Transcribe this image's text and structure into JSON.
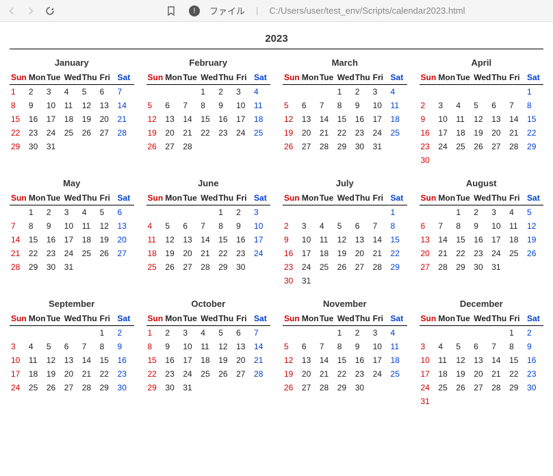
{
  "toolbar": {
    "file_label": "ファイル",
    "path": "C:/Users/user/test_env/Scripts/calendar2023.html"
  },
  "title": "2023",
  "weekdays": [
    "Sun",
    "Mon",
    "Tue",
    "Wed",
    "Thu",
    "Fri",
    "Sat"
  ],
  "months": [
    {
      "name": "January",
      "start": 0,
      "days": 31
    },
    {
      "name": "February",
      "start": 3,
      "days": 28
    },
    {
      "name": "March",
      "start": 3,
      "days": 31
    },
    {
      "name": "April",
      "start": 6,
      "days": 30
    },
    {
      "name": "May",
      "start": 1,
      "days": 31
    },
    {
      "name": "June",
      "start": 4,
      "days": 30
    },
    {
      "name": "July",
      "start": 6,
      "days": 31
    },
    {
      "name": "August",
      "start": 2,
      "days": 31
    },
    {
      "name": "September",
      "start": 5,
      "days": 30
    },
    {
      "name": "October",
      "start": 0,
      "days": 31
    },
    {
      "name": "November",
      "start": 3,
      "days": 30
    },
    {
      "name": "December",
      "start": 5,
      "days": 31
    }
  ]
}
